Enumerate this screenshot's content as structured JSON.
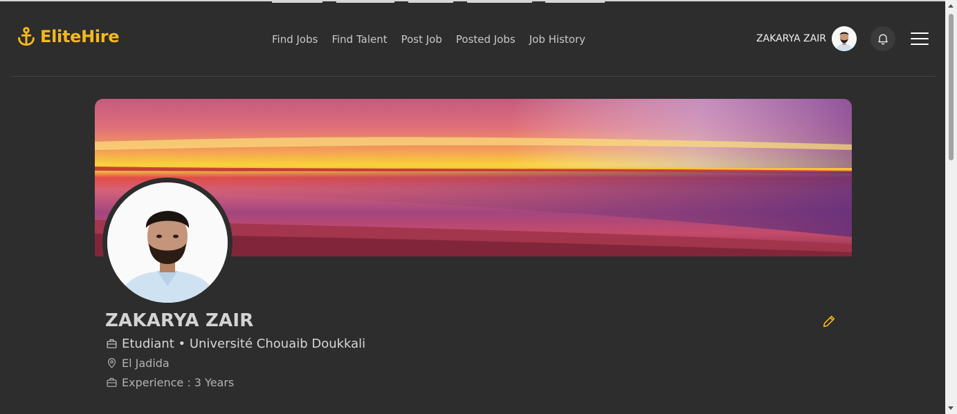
{
  "app": {
    "logo_text": "EliteHire",
    "brand_color": "#f4b91c"
  },
  "nav": {
    "links": [
      {
        "label": "Find Jobs"
      },
      {
        "label": "Find Talent"
      },
      {
        "label": "Post Job"
      },
      {
        "label": "Posted Jobs"
      },
      {
        "label": "Job History"
      }
    ]
  },
  "user": {
    "name": "ZAKARYA ZAIR"
  },
  "profile": {
    "name": "ZAKARYA ZAIR",
    "headline": "Etudiant • Université Chouaib Doukkali",
    "location": "El Jadida",
    "experience": "Experience : 3 Years"
  },
  "icons": {
    "logo": "anchor-icon",
    "notifications": "bell-icon",
    "menu": "hamburger-menu-icon",
    "edit": "pencil-icon",
    "headline": "briefcase-icon",
    "location": "map-pin-icon",
    "experience": "briefcase-icon"
  }
}
